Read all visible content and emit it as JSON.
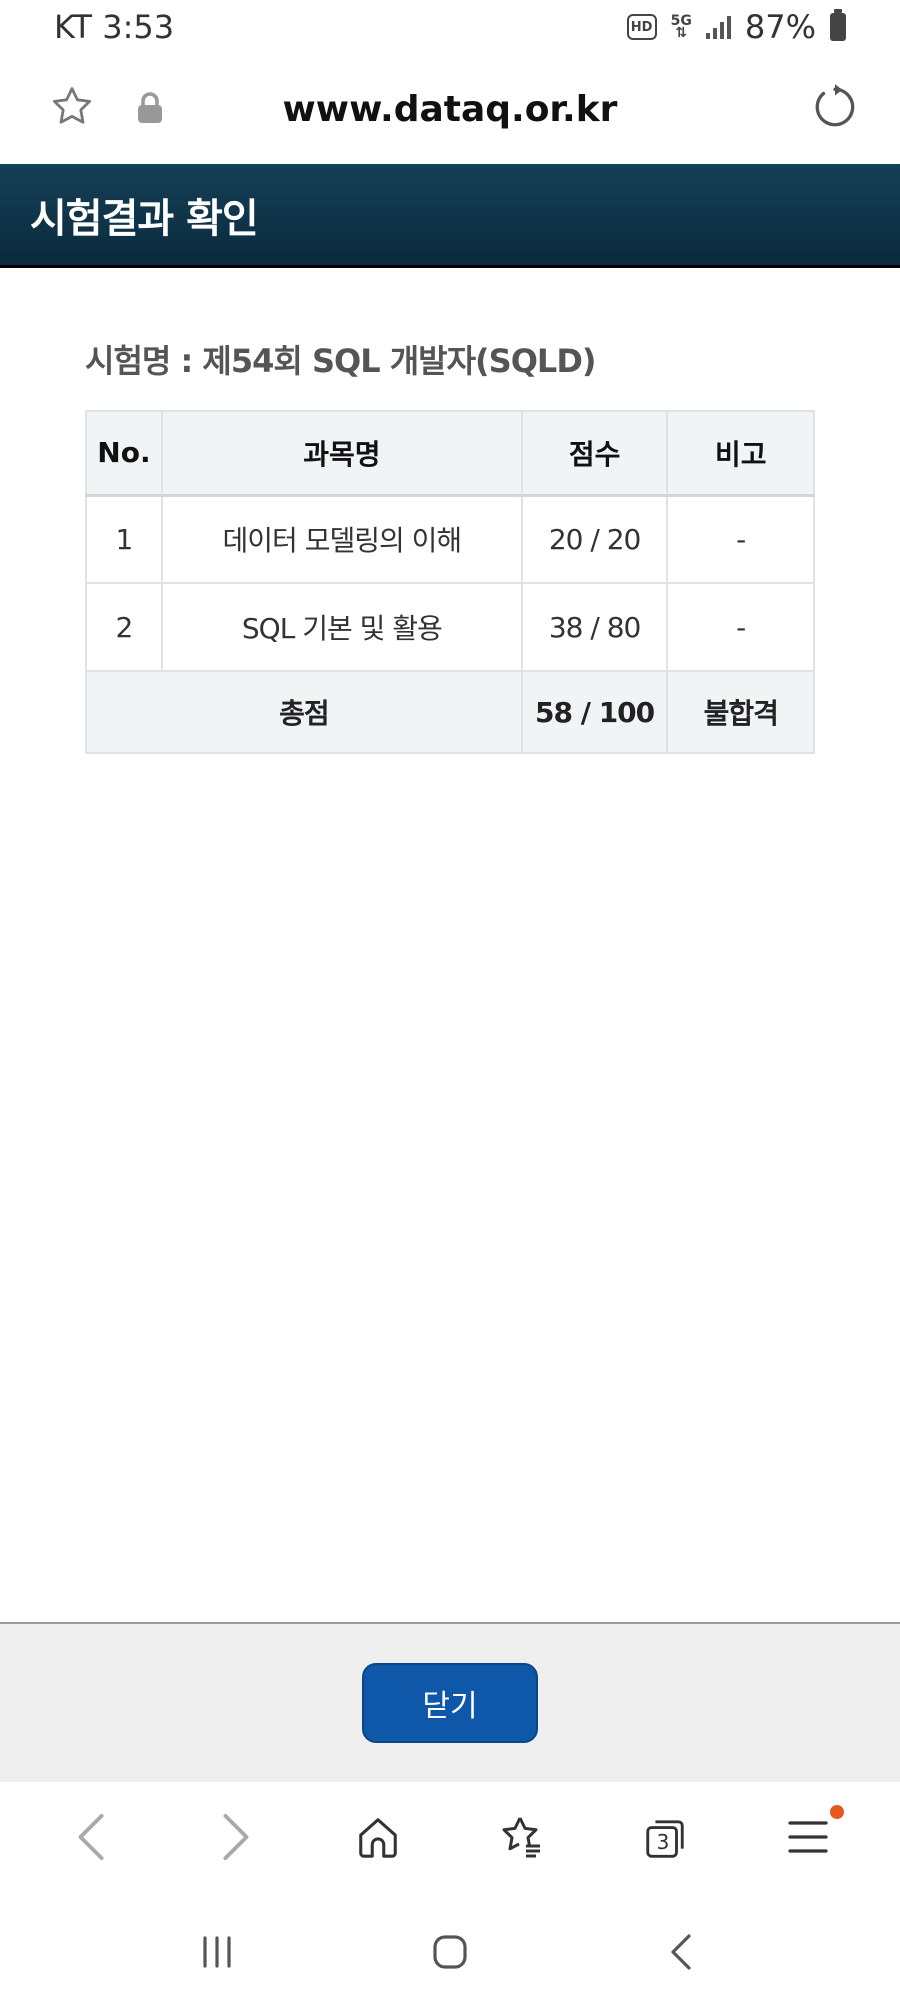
{
  "status_bar": {
    "carrier_time": "KT 3:53",
    "hd_label": "HD",
    "network_label": "5G",
    "battery": "87%"
  },
  "browser": {
    "url": "www.dataq.or.kr",
    "tab_count": "3"
  },
  "page": {
    "header_title": "시험결과 확인",
    "exam_title": "시험명 : 제54회 SQL 개발자(SQLD)"
  },
  "table": {
    "headers": {
      "no": "No.",
      "subject": "과목명",
      "score": "점수",
      "remark": "비고"
    },
    "rows": [
      {
        "no": "1",
        "subject": "데이터 모델링의 이해",
        "score": "20 / 20",
        "remark": "-"
      },
      {
        "no": "2",
        "subject": "SQL 기본 및 활용",
        "score": "38 / 80",
        "remark": "-"
      }
    ],
    "total": {
      "label": "총점",
      "score": "58 / 100",
      "result": "불합격"
    }
  },
  "footer": {
    "close_label": "닫기"
  },
  "colors": {
    "header_bg": "#154057",
    "close_button": "#0f57a8",
    "table_header_bg": "#f1f4f5",
    "notification_dot": "#e5591d"
  },
  "icons": {
    "url_bar": [
      "star-outline-icon",
      "lock-icon",
      "refresh-icon"
    ],
    "toolbar": [
      "back-arrow-icon",
      "forward-arrow-icon",
      "home-icon",
      "bookmarks-icon",
      "tabs-icon",
      "menu-icon"
    ],
    "nav": [
      "recent-apps-icon",
      "home-nav-icon",
      "back-nav-icon"
    ]
  }
}
